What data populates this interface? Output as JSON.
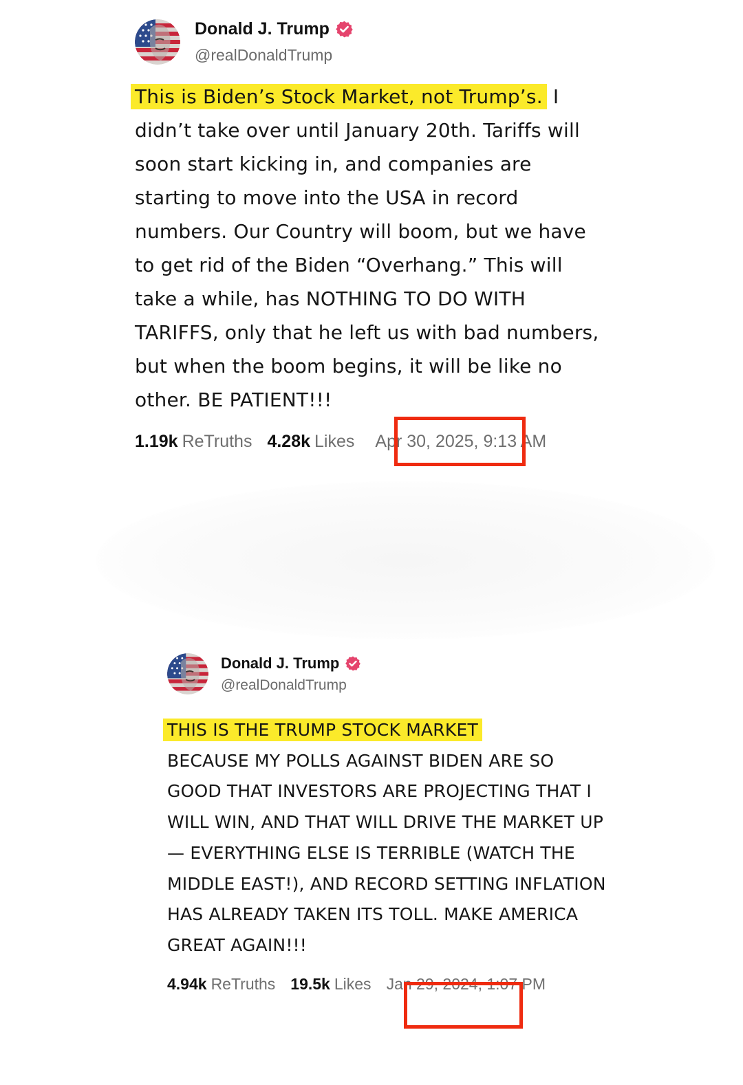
{
  "posts": [
    {
      "display_name": "Donald J. Trump",
      "handle": "@realDonaldTrump",
      "highlighted_text": "This is Biden’s Stock Market, not Trump’s.",
      "body_text": " I didn’t take over until January 20th. Tariffs will soon start kicking in, and companies are starting to move into the USA in record numbers. Our Country will boom, but we have to get rid of the Biden “Overhang.” This will take a while, has NOTHING TO DO WITH TARIFFS, only that he left us with bad numbers, but when the boom begins, it will be like no other. BE PATIENT!!!",
      "retruths_count": "1.19k",
      "retruths_label": "ReTruths",
      "likes_count": "4.28k",
      "likes_label": "Likes",
      "timestamp": "Apr 30, 2025, 9:13 AM"
    },
    {
      "display_name": "Donald J. Trump",
      "handle": "@realDonaldTrump",
      "highlighted_text": "THIS IS THE TRUMP STOCK MARKET",
      "body_text": "BECAUSE MY POLLS AGAINST BIDEN ARE SO GOOD THAT INVESTORS ARE PROJECTING THAT I WILL WIN, AND THAT WILL DRIVE THE MARKET UP — EVERYTHING ELSE IS TERRIBLE (WATCH THE MIDDLE EAST!), AND RECORD SETTING INFLATION HAS ALREADY TAKEN ITS TOLL. MAKE AMERICA GREAT AGAIN!!!",
      "retruths_count": "4.94k",
      "retruths_label": "ReTruths",
      "likes_count": "19.5k",
      "likes_label": "Likes",
      "timestamp": "Jan 29, 2024, 1:07 PM"
    }
  ],
  "icons": {
    "avatar": "flag-face-avatar-icon",
    "verified": "verified-badge-icon"
  },
  "colors": {
    "highlight": "#fbea2a",
    "annotation_box": "#ef2b10",
    "verified_badge": "#e5446d"
  }
}
